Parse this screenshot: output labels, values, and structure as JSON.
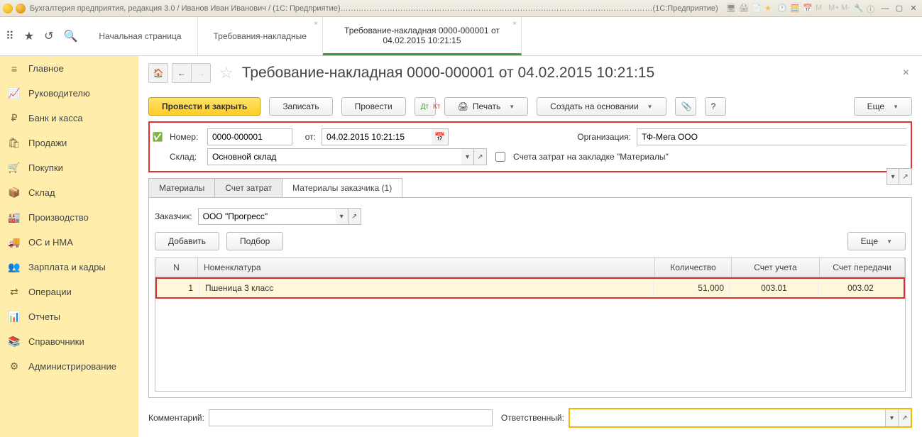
{
  "titlebar": {
    "text": "Бухгалтерия предприятия, редакция 3.0 / Иванов Иван Иванович / (1С: Предприятие)…………………………………………………………………………………………………………(1С:Предприятие)"
  },
  "tabs": [
    {
      "label": "Начальная страница",
      "closable": false
    },
    {
      "label": "Требования-накладные",
      "closable": true
    },
    {
      "label": "Требование-накладная 0000-000001 от 04.02.2015 10:21:15",
      "closable": true,
      "active": true
    }
  ],
  "sidebar": [
    {
      "icon": "≡",
      "label": "Главное"
    },
    {
      "icon": "📈",
      "label": "Руководителю"
    },
    {
      "icon": "₽",
      "label": "Банк и касса"
    },
    {
      "icon": "🛍",
      "label": "Продажи"
    },
    {
      "icon": "🛒",
      "label": "Покупки"
    },
    {
      "icon": "📦",
      "label": "Склад"
    },
    {
      "icon": "🏭",
      "label": "Производство"
    },
    {
      "icon": "🚚",
      "label": "ОС и НМА"
    },
    {
      "icon": "👥",
      "label": "Зарплата и кадры"
    },
    {
      "icon": "⇄",
      "label": "Операции"
    },
    {
      "icon": "📊",
      "label": "Отчеты"
    },
    {
      "icon": "📚",
      "label": "Справочники"
    },
    {
      "icon": "⚙",
      "label": "Администрирование"
    }
  ],
  "page": {
    "title": "Требование-накладная 0000-000001 от 04.02.2015 10:21:15"
  },
  "toolbar": {
    "primary": "Провести и закрыть",
    "save": "Записать",
    "post": "Провести",
    "print": "Печать",
    "base": "Создать на основании",
    "more": "Еще"
  },
  "fields": {
    "number_label": "Номер:",
    "number": "0000-000001",
    "date_label": "от:",
    "date": "04.02.2015 10:21:15",
    "org_label": "Организация:",
    "org": "ТФ-Мега ООО",
    "warehouse_label": "Склад:",
    "warehouse": "Основной склад",
    "checkbox_label": "Счета затрат на закладке \"Материалы\""
  },
  "doc_tabs": {
    "t1": "Материалы",
    "t2": "Счет затрат",
    "t3": "Материалы заказчика (1)"
  },
  "customer": {
    "label": "Заказчик:",
    "value": "ООО \"Прогресс\""
  },
  "sub_toolbar": {
    "add": "Добавить",
    "pick": "Подбор",
    "more": "Еще"
  },
  "grid": {
    "headers": {
      "n": "N",
      "nom": "Номенклатура",
      "qty": "Количество",
      "acc": "Счет учета",
      "tr": "Счет передачи"
    },
    "rows": [
      {
        "n": "1",
        "nom": "Пшеница 3 класс",
        "qty": "51,000",
        "acc": "003.01",
        "tr": "003.02"
      }
    ]
  },
  "bottom": {
    "comment_label": "Комментарий:",
    "comment": "",
    "resp_label": "Ответственный:",
    "resp": ""
  }
}
